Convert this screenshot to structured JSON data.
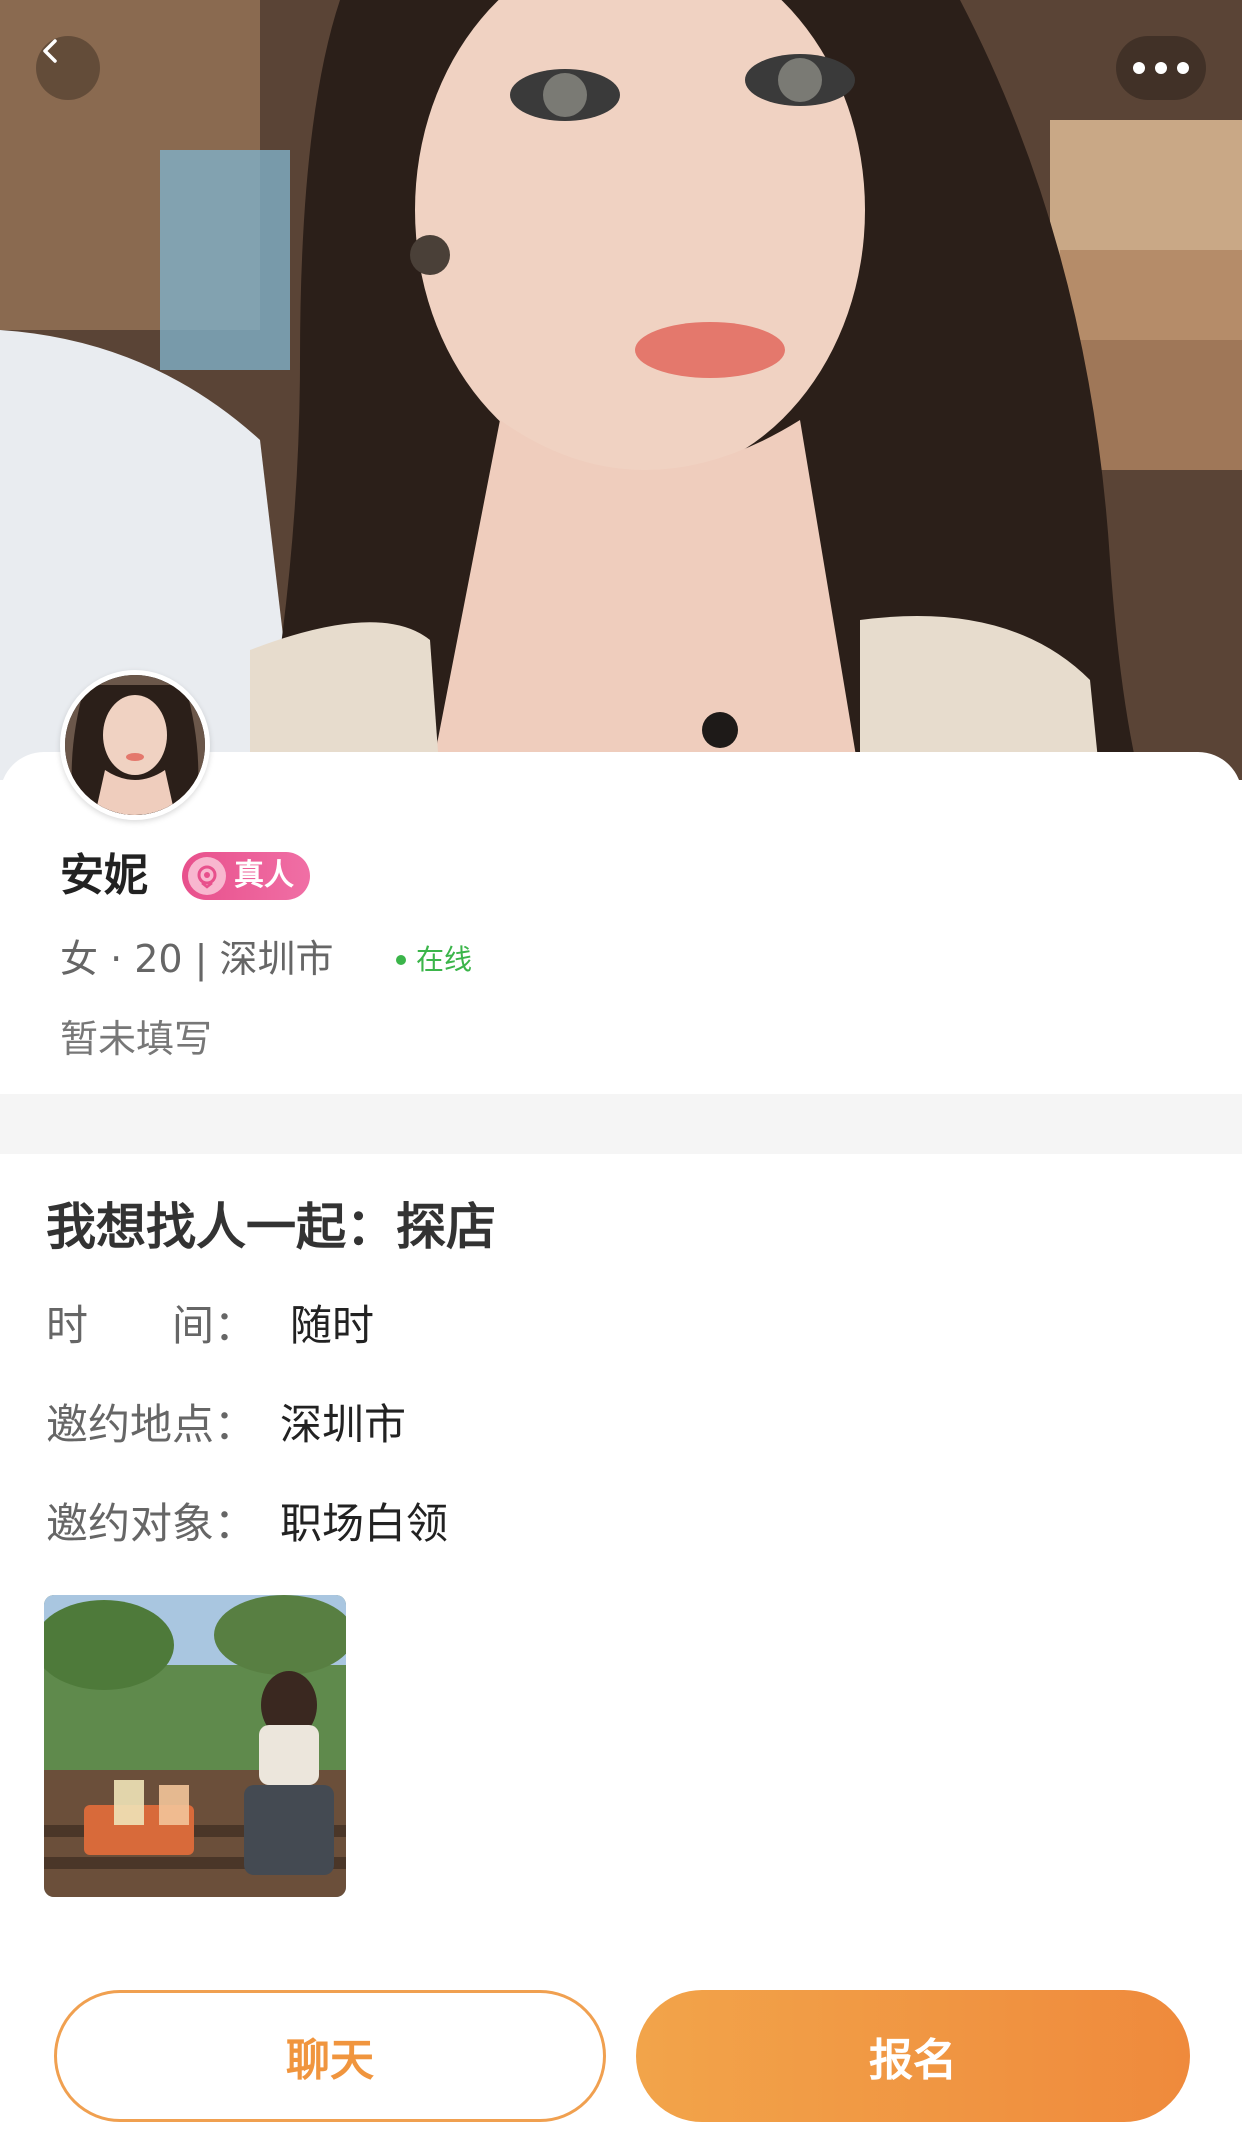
{
  "profile": {
    "name": "安妮",
    "verified_badge": "真人",
    "meta": "女 · 20 | 深圳市",
    "online_status": "在线",
    "bio": "暂未填写"
  },
  "activity": {
    "title": "我想找人一起：探店",
    "time_label": "时　　间：",
    "time_value": "随时",
    "place_label": "邀约地点：",
    "place_value": "深圳市",
    "target_label": "邀约对象：",
    "target_value": "职场白领"
  },
  "actions": {
    "chat_label": "聊天",
    "signup_label": "报名"
  },
  "icons": {
    "back": "chevron-left-icon",
    "more": "more-dots-icon",
    "badge": "rose-badge-icon"
  },
  "colors": {
    "accent_orange": "#ef8a3c",
    "badge_pink": "#e8508c",
    "online_green": "#3bb54a"
  }
}
